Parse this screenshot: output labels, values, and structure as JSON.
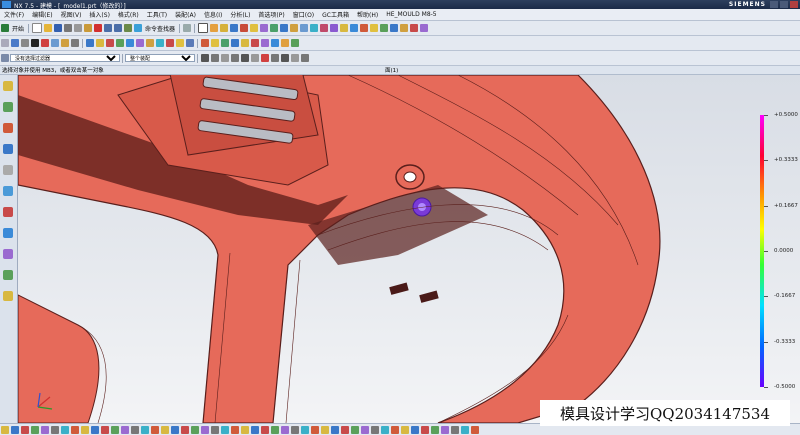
{
  "window": {
    "title": "NX 7.5 - 建模 - [_model1.prt（修改的）]",
    "brand": "SIEMENS"
  },
  "menu": [
    "文件(F)",
    "编辑(E)",
    "视图(V)",
    "插入(S)",
    "格式(R)",
    "工具(T)",
    "装配(A)",
    "信息(I)",
    "分析(L)",
    "首选项(P)",
    "窗口(O)",
    "GC工具箱",
    "帮助(H)",
    "HE_MOULD M8-5"
  ],
  "toolbar1": {
    "start_label": "开始",
    "cmd_finder": "命令查找器"
  },
  "toolbar3": {
    "filter": "没有选择过滤器",
    "scope": "整个装配"
  },
  "selection_bar": {
    "prompt": "选择对象并使用 MB3，或者双击某一对象",
    "status": "面(1)"
  },
  "scale": {
    "labels": [
      "+0.5000",
      "+0.3333",
      "+0.1667",
      "0.0000",
      "-0.1667",
      "-0.3333",
      "-0.5000"
    ]
  },
  "watermark": "模具设计学习QQ2034147534",
  "colors": {
    "part": "#e66a5a",
    "edge": "#5a1f1c",
    "ui_bg": "#e4e9f1"
  }
}
